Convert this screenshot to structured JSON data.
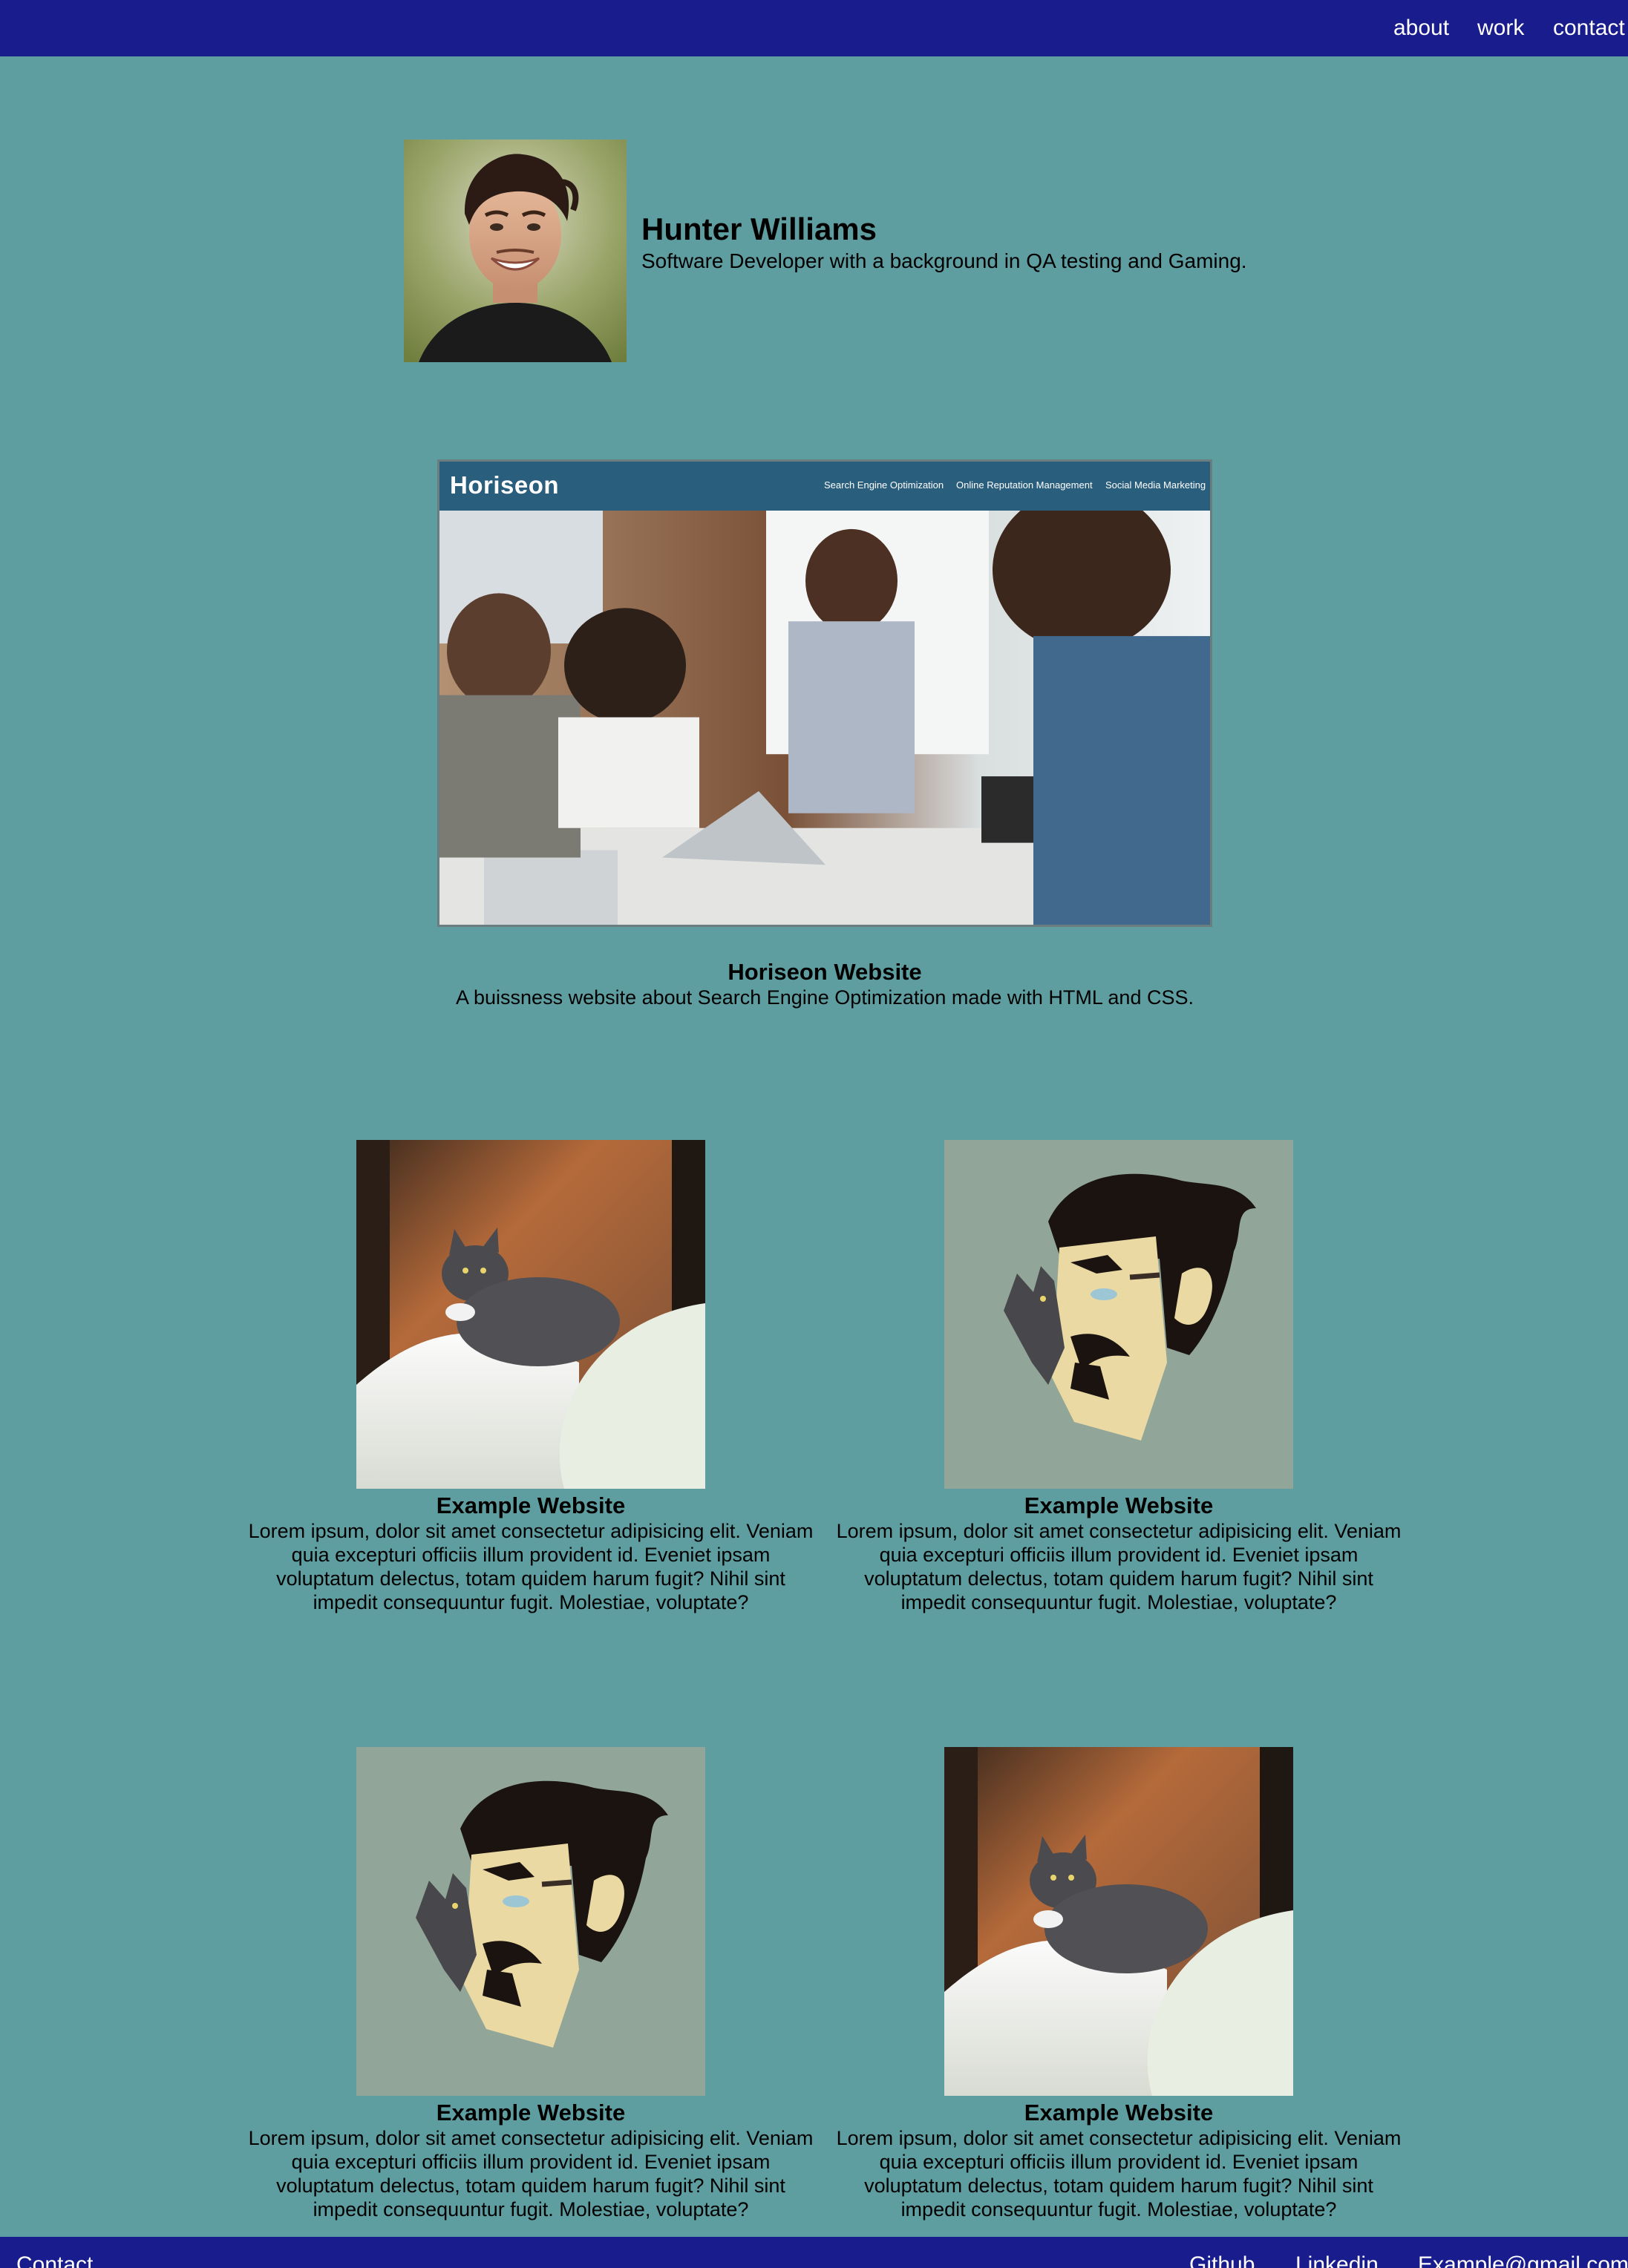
{
  "nav": {
    "about": "about",
    "work": "work",
    "contact": "contact"
  },
  "profile": {
    "name": "Hunter Williams",
    "description": "Software Developer with a background in QA testing and Gaming."
  },
  "featured": {
    "screenshot": {
      "logo": "Horiseon",
      "menu": [
        "Search Engine Optimization",
        "Online Reputation Management",
        "Social Media Marketing"
      ]
    },
    "title": "Horiseon Website",
    "description": "A buissness website about Search Engine Optimization made with HTML and CSS."
  },
  "projects": [
    {
      "title": "Example Website",
      "description": "Lorem ipsum, dolor sit amet consectetur adipisicing elit. Veniam quia excepturi officiis illum provident id. Eveniet ipsam voluptatum delectus, totam quidem harum fugit? Nihil sint impedit consequuntur fugit. Molestiae, voluptate?"
    },
    {
      "title": "Example Website",
      "description": "Lorem ipsum, dolor sit amet consectetur adipisicing elit. Veniam quia excepturi officiis illum provident id. Eveniet ipsam voluptatum delectus, totam quidem harum fugit? Nihil sint impedit consequuntur fugit. Molestiae, voluptate?"
    },
    {
      "title": "Example Website",
      "description": "Lorem ipsum, dolor sit amet consectetur adipisicing elit. Veniam quia excepturi officiis illum provident id. Eveniet ipsam voluptatum delectus, totam quidem harum fugit? Nihil sint impedit consequuntur fugit. Molestiae, voluptate?"
    },
    {
      "title": "Example Website",
      "description": "Lorem ipsum, dolor sit amet consectetur adipisicing elit. Veniam quia excepturi officiis illum provident id. Eveniet ipsam voluptatum delectus, totam quidem harum fugit? Nihil sint impedit consequuntur fugit. Molestiae, voluptate?"
    }
  ],
  "footer": {
    "contact": "Contact",
    "github": "Github",
    "linkedin": "Linkedin",
    "email": "Example@gmail.com"
  },
  "colors": {
    "page_background": "#5f9ea0",
    "navbar": "#191c8c",
    "featured_header": "#2a5e7d",
    "text": "#000000",
    "nav_text": "#ffffff"
  }
}
